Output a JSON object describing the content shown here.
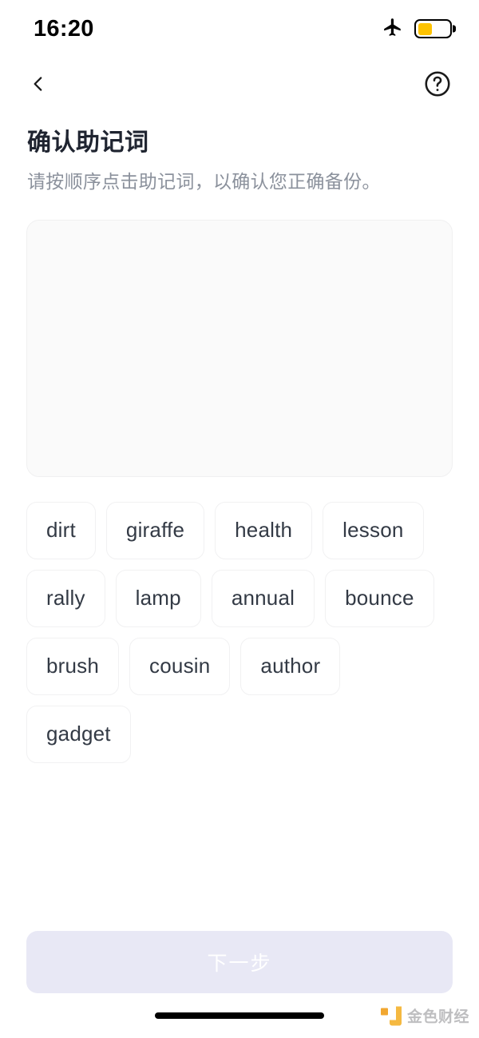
{
  "status_bar": {
    "time": "16:20",
    "airplane_icon": "airplane-mode-icon",
    "battery_icon": "battery-icon",
    "battery_level_percent": 45,
    "battery_color": "#fec300"
  },
  "nav": {
    "back_icon": "chevron-left-icon",
    "help_icon": "question-mark-circle-icon"
  },
  "heading": {
    "title": "确认助记词",
    "subtitle": "请按顺序点击助记词，以确认您正确备份。"
  },
  "answer_panel": {
    "selected_words": []
  },
  "word_pool": {
    "words": [
      "dirt",
      "giraffe",
      "health",
      "lesson",
      "rally",
      "lamp",
      "annual",
      "bounce",
      "brush",
      "cousin",
      "author",
      "gadget"
    ]
  },
  "footer": {
    "next_label": "下一步",
    "next_enabled": false,
    "next_disabled_color": "#e8e8f5"
  },
  "bottom_bar": {
    "home_indicator": "home-indicator",
    "watermark_text": "金色财经",
    "watermark_logo_color": "#f5b431"
  }
}
